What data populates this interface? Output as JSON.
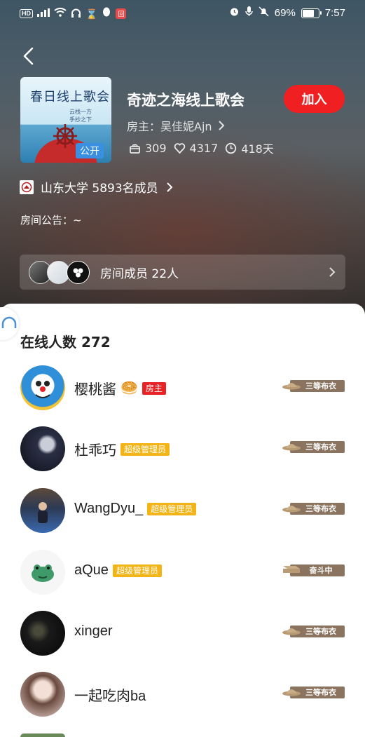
{
  "status_bar": {
    "hd": "HD",
    "network": "4G",
    "badge": "回",
    "battery": "69%",
    "time": "7:57"
  },
  "room": {
    "cover_title": "春日线上歌会",
    "cover_sub1": "云栈一方",
    "cover_sub2": "手抄之下",
    "cover_badge": "公开",
    "title": "奇迹之海线上歌会",
    "host_label": "房主：吴佳妮Ajn",
    "join_label": "加入",
    "stats": {
      "gifts": "309",
      "likes": "4317",
      "days": "418天"
    },
    "school": "山东大学 5893名成员",
    "announcement": "房间公告：~",
    "members_label": "房间成员 22人"
  },
  "online": {
    "title": "在线人数 272",
    "users": [
      {
        "name": "樱桃酱",
        "emoji": "🥯",
        "role": "房主",
        "role_type": "host",
        "level": "三等布衣",
        "avatar_color": "#2f8fd8"
      },
      {
        "name": "杜乖巧",
        "emoji": "",
        "role": "超级管理员",
        "role_type": "admin",
        "level": "三等布衣",
        "avatar_color": "#1d2030"
      },
      {
        "name": "WangDyu_",
        "emoji": "",
        "role": "超级管理员",
        "role_type": "admin",
        "level": "三等布衣",
        "avatar_color": "#2a3550"
      },
      {
        "name": "aQue",
        "emoji": "",
        "role": "超级管理员",
        "role_type": "admin",
        "level": "奋斗中",
        "avatar_color": "#f4f4f4"
      },
      {
        "name": "xinger",
        "emoji": "",
        "role": "",
        "role_type": "",
        "level": "三等布衣",
        "avatar_color": "#101010"
      },
      {
        "name": "一起吃肉ba",
        "emoji": "",
        "role": "",
        "role_type": "",
        "level": "三等布衣",
        "avatar_color": "#e8d4d0"
      }
    ]
  },
  "colors": {
    "join": "#ef1f22",
    "host_badge": "#e82325",
    "admin_badge": "#f3b418",
    "level_tag": "#8a7460"
  }
}
